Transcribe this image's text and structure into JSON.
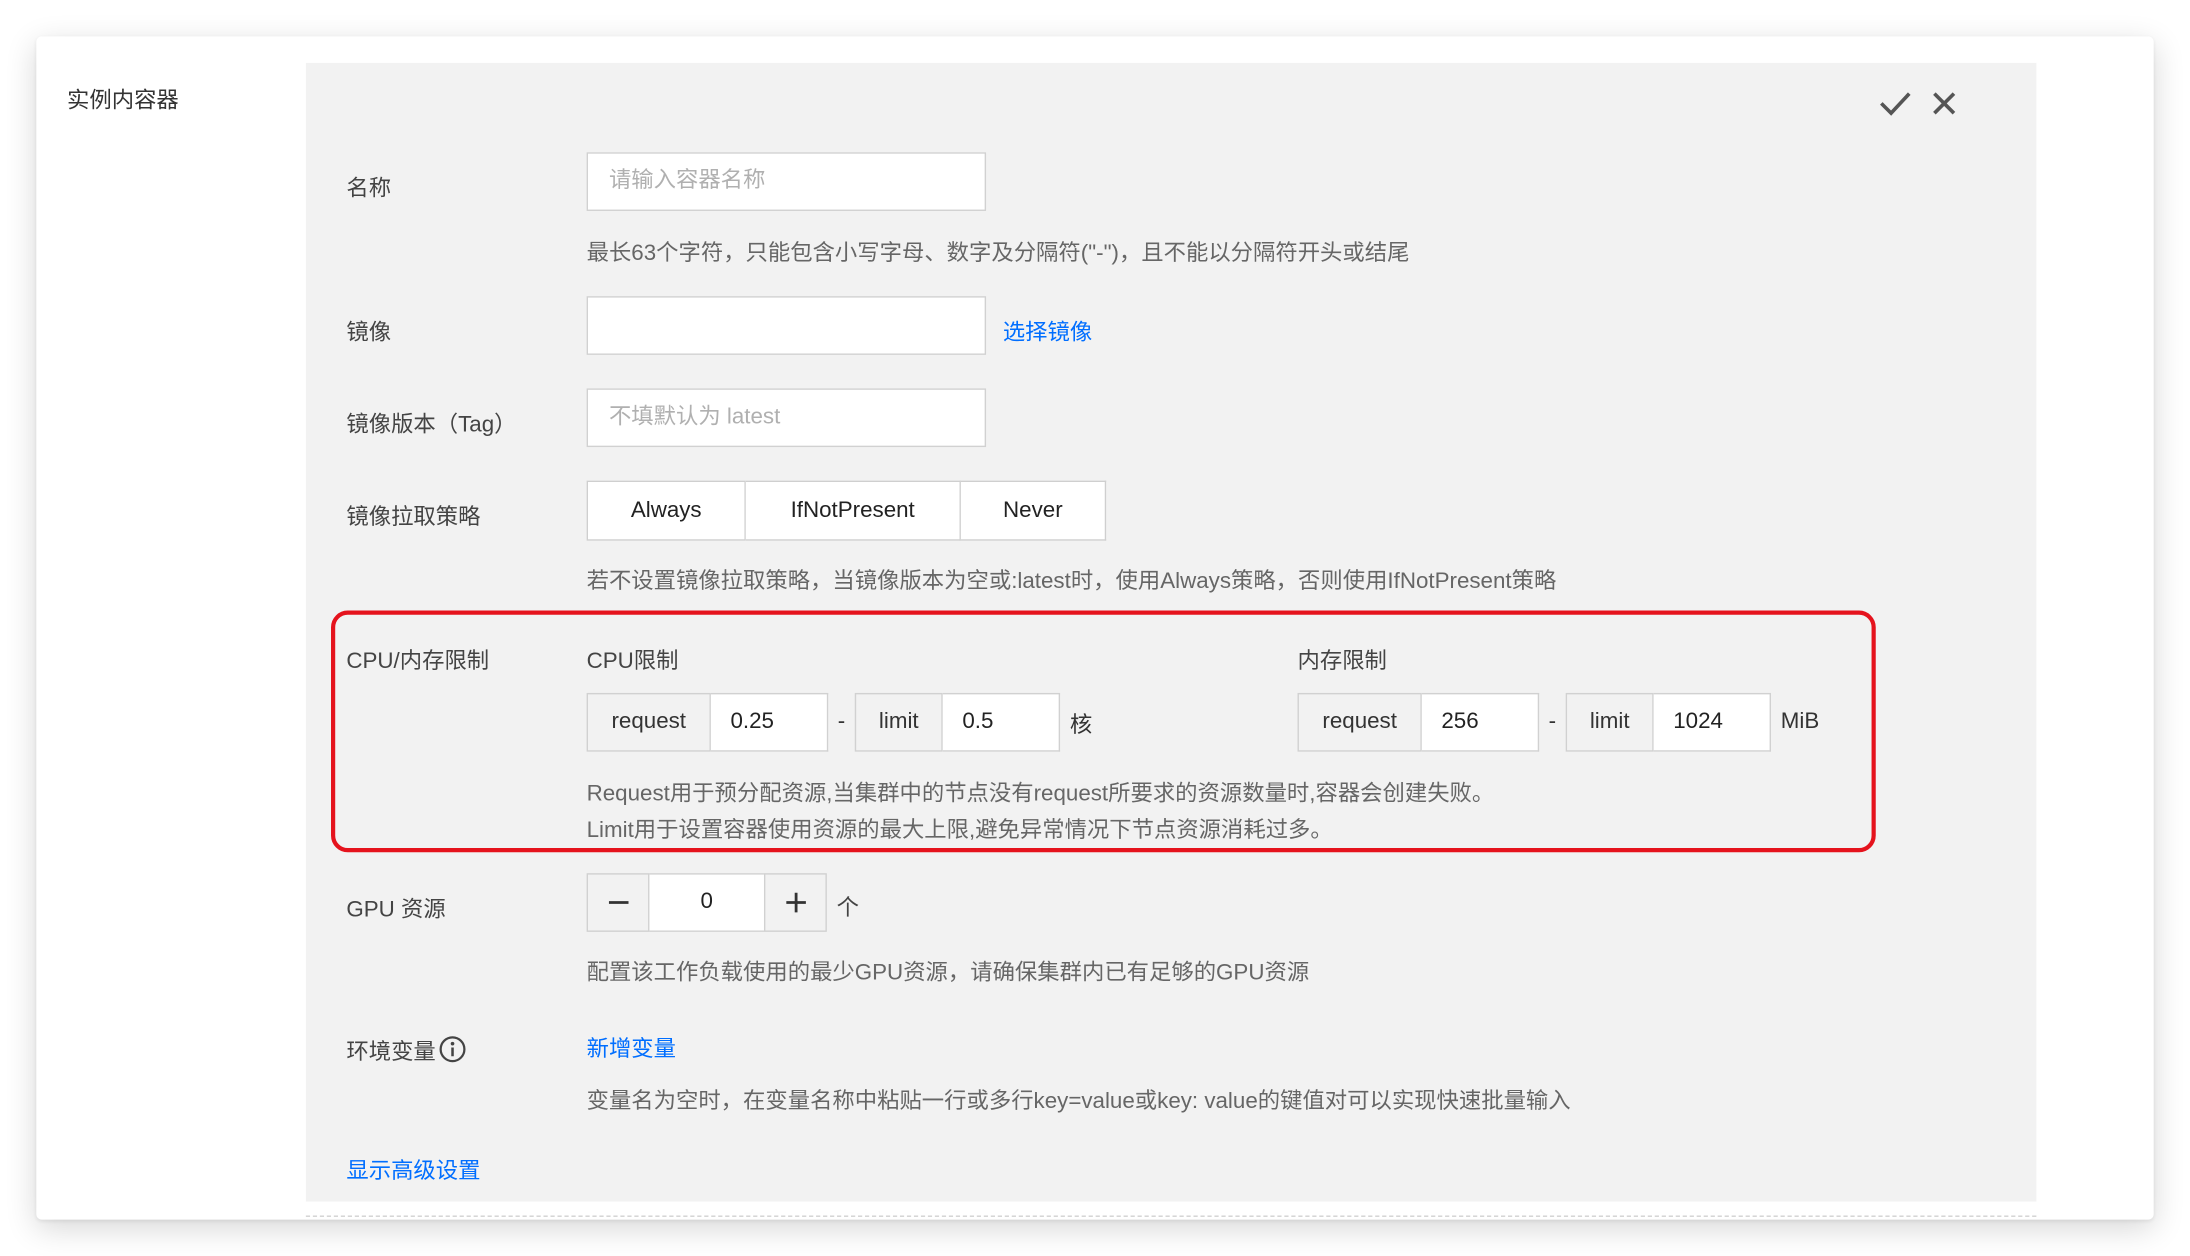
{
  "section_title": "实例内容器",
  "header_actions": {
    "confirm_icon": "check-icon",
    "close_icon": "close-icon"
  },
  "name": {
    "label": "名称",
    "placeholder": "请输入容器名称",
    "hint": "最长63个字符，只能包含小写字母、数字及分隔符(\"-\")，且不能以分隔符开头或结尾"
  },
  "image": {
    "label": "镜像",
    "value": "",
    "select_link": "选择镜像"
  },
  "image_tag": {
    "label": "镜像版本（Tag）",
    "placeholder": "不填默认为 latest"
  },
  "pull_policy": {
    "label": "镜像拉取策略",
    "options": [
      "Always",
      "IfNotPresent",
      "Never"
    ],
    "hint": "若不设置镜像拉取策略，当镜像版本为空或:latest时，使用Always策略，否则使用IfNotPresent策略"
  },
  "limits": {
    "label": "CPU/内存限制",
    "cpu": {
      "title": "CPU限制",
      "request_label": "request",
      "request_value": "0.25",
      "separator": "-",
      "limit_label": "limit",
      "limit_value": "0.5",
      "unit": "核"
    },
    "memory": {
      "title": "内存限制",
      "request_label": "request",
      "request_value": "256",
      "separator": "-",
      "limit_label": "limit",
      "limit_value": "1024",
      "unit": "MiB"
    },
    "hint_line1": "Request用于预分配资源,当集群中的节点没有request所要求的资源数量时,容器会创建失败。",
    "hint_line2": "Limit用于设置容器使用资源的最大上限,避免异常情况下节点资源消耗过多。"
  },
  "gpu": {
    "label": "GPU 资源",
    "value": "0",
    "unit": "个",
    "hint": "配置该工作负载使用的最少GPU资源，请确保集群内已有足够的GPU资源"
  },
  "env": {
    "label": "环境变量",
    "info_icon": "info-icon",
    "add_link": "新增变量",
    "hint": "变量名为空时，在变量名称中粘贴一行或多行key=value或key: value的键值对可以实现快速批量输入"
  },
  "advanced_link": "显示高级设置",
  "highlight_color": "#e5131d",
  "link_color": "#006eff"
}
